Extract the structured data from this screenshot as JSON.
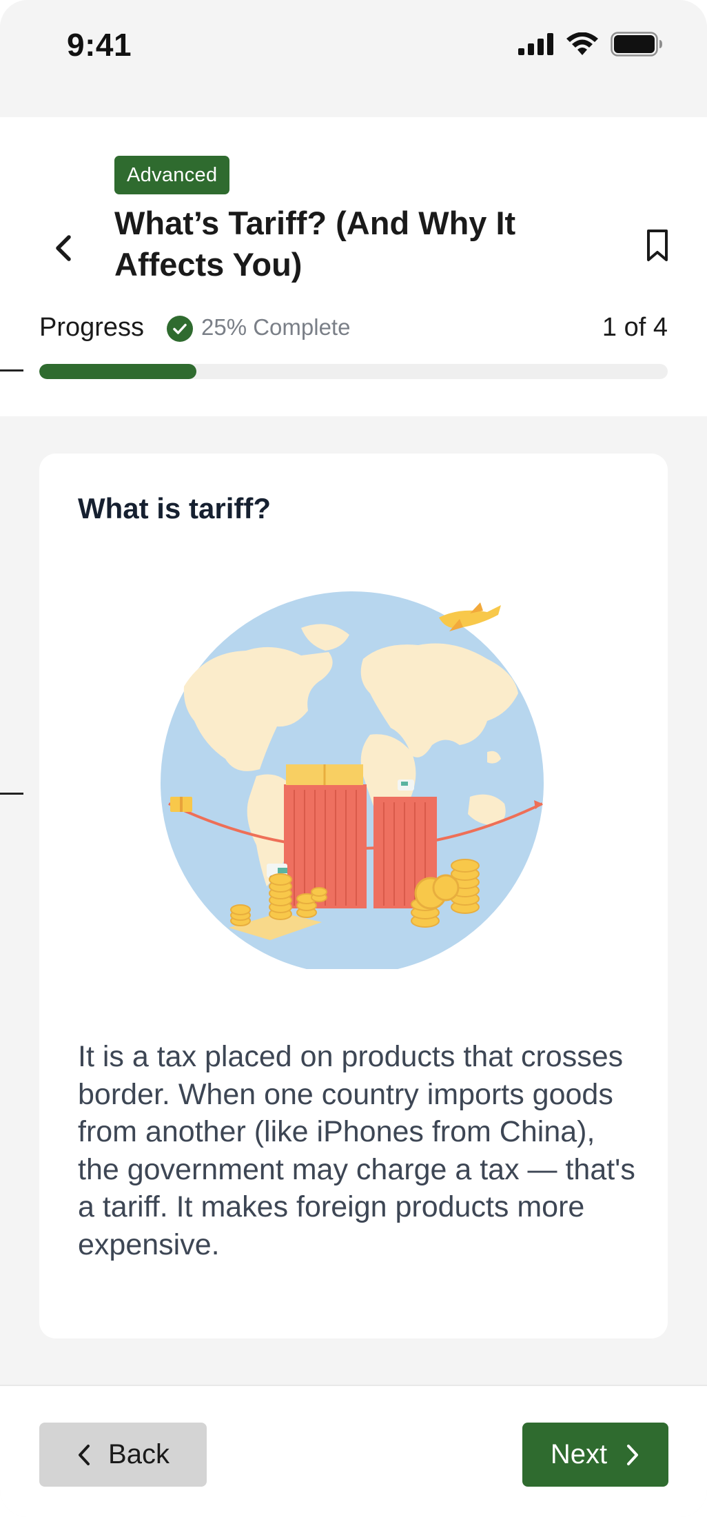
{
  "status_bar": {
    "time": "9:41",
    "icons": [
      "cellular-signal-icon",
      "wifi-icon",
      "battery-icon"
    ]
  },
  "header": {
    "level_badge": "Advanced",
    "title": "What’s Tariff? (And Why It Affects You)",
    "back_icon": "chevron-left-icon",
    "bookmark_icon": "bookmark-icon"
  },
  "progress": {
    "label": "Progress",
    "percent_text": "25% Complete",
    "step_text": "1 of 4",
    "value": 0.25
  },
  "card": {
    "title": "What is tariff?",
    "illustration": "globe-trade-illustration",
    "body": "It is a tax placed on products that crosses border. When one country imports goods from another (like iPhones from China), the government may charge a tax — that's a tariff. It makes foreign products more expensive."
  },
  "footer": {
    "back_label": "Back",
    "next_label": "Next"
  },
  "colors": {
    "accent": "#2f6b2f",
    "background": "#f4f4f4",
    "card": "#ffffff",
    "muted_text": "#7a7f87"
  }
}
